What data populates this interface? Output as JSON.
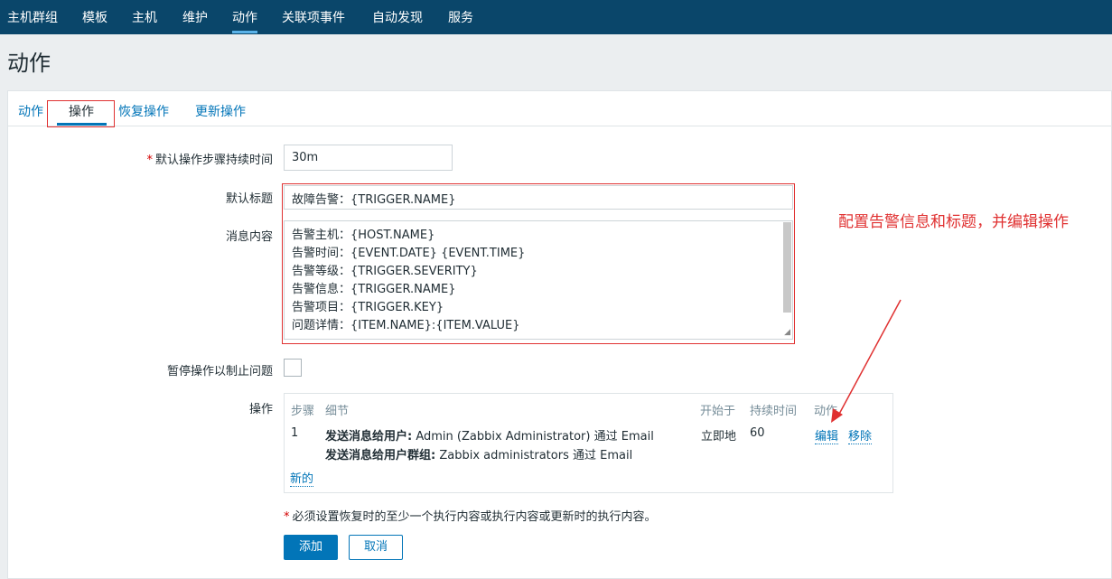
{
  "nav": {
    "items": [
      "主机群组",
      "模板",
      "主机",
      "维护",
      "动作",
      "关联项事件",
      "自动发现",
      "服务"
    ],
    "active_index": 4
  },
  "page": {
    "title": "动作"
  },
  "tabs": {
    "items": [
      "动作",
      "操作",
      "恢复操作",
      "更新操作"
    ],
    "active_index": 1
  },
  "form": {
    "step_duration": {
      "label": "默认操作步骤持续时间",
      "value": "30m"
    },
    "default_subject": {
      "label": "默认标题",
      "value": "故障告警：{TRIGGER.NAME}"
    },
    "message": {
      "label": "消息内容",
      "lines": [
        "告警主机：{HOST.NAME}",
        "告警时间：{EVENT.DATE}  {EVENT.TIME}",
        "告警等级：{TRIGGER.SEVERITY}",
        "告警信息：{TRIGGER.NAME}",
        "告警项目：{TRIGGER.KEY}",
        "问题详情：{ITEM.NAME}:{ITEM.VALUE}"
      ]
    },
    "pause": {
      "label": "暂停操作以制止问题",
      "checked": false
    },
    "operations": {
      "label": "操作",
      "headers": [
        "步骤",
        "细节",
        "开始于",
        "持续时间",
        "动作"
      ],
      "rows": [
        {
          "step": "1",
          "detail_1_bold": "发送消息给用户:",
          "detail_1_rest": " Admin (Zabbix Administrator) 通过 Email",
          "detail_2_bold": "发送消息给用户群组:",
          "detail_2_rest": " Zabbix administrators 通过 Email",
          "start": "立即地",
          "duration": "60",
          "edit": "编辑",
          "remove": "移除"
        }
      ],
      "new_link": "新的"
    },
    "note": "必须设置恢复时的至少一个执行内容或执行内容或更新时的执行内容。",
    "add_button": "添加",
    "cancel_button": "取消"
  },
  "annotation": {
    "text": "配置告警信息和标题，并编辑操作",
    "color": "#e03131"
  },
  "colors": {
    "nav_bg": "#0a466a",
    "link": "#0275b8",
    "accent": "#e03131"
  }
}
